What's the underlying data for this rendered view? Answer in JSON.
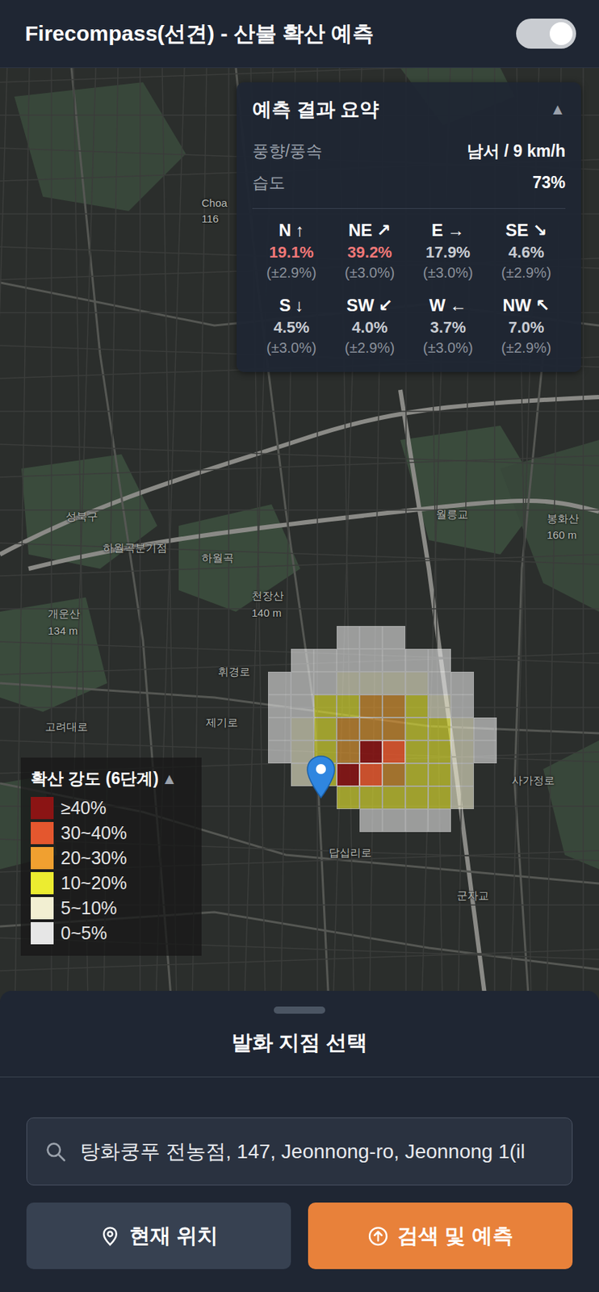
{
  "header": {
    "title": "Firecompass(선견) - 산불 확산 예측",
    "toggle_on": true
  },
  "summary": {
    "title": "예측 결과 요약",
    "collapse": "▲",
    "rows": [
      {
        "label": "풍향/풍속",
        "value": "남서 / 9 km/h"
      },
      {
        "label": "습도",
        "value": "73%"
      }
    ],
    "directions": [
      {
        "label": "N",
        "arrow": "↑",
        "pct": "19.1%",
        "err": "(±2.9%)",
        "highlighted": true
      },
      {
        "label": "NE",
        "arrow": "↗",
        "pct": "39.2%",
        "err": "(±3.0%)",
        "highlighted": true
      },
      {
        "label": "E",
        "arrow": "→",
        "pct": "17.9%",
        "err": "(±3.0%)",
        "highlighted": false
      },
      {
        "label": "SE",
        "arrow": "↘",
        "pct": "4.6%",
        "err": "(±2.9%)",
        "highlighted": false
      },
      {
        "label": "S",
        "arrow": "↓",
        "pct": "4.5%",
        "err": "(±3.0%)",
        "highlighted": false
      },
      {
        "label": "SW",
        "arrow": "↙",
        "pct": "4.0%",
        "err": "(±2.9%)",
        "highlighted": false
      },
      {
        "label": "W",
        "arrow": "←",
        "pct": "3.7%",
        "err": "(±3.0%)",
        "highlighted": false
      },
      {
        "label": "NW",
        "arrow": "↖",
        "pct": "7.0%",
        "err": "(±2.9%)",
        "highlighted": false
      }
    ]
  },
  "map": {
    "labels": [
      "Choa",
      "116",
      "성북구",
      "하월곡분기점",
      "하월곡",
      "천장산",
      "140 m",
      "개운산",
      "134 m",
      "월릉교",
      "봉화산",
      "160 m",
      "휘경로",
      "제기로",
      "고려대로",
      "사가정로",
      "답십리로",
      "군자교"
    ],
    "grid": [
      [
        null,
        null,
        null,
        5,
        5,
        5,
        null,
        null,
        null,
        null
      ],
      [
        null,
        5,
        5,
        5,
        5,
        5,
        5,
        5,
        null,
        null
      ],
      [
        5,
        5,
        5,
        4,
        4,
        4,
        4,
        5,
        5,
        null
      ],
      [
        5,
        5,
        3,
        3,
        2,
        2,
        3,
        4,
        5,
        null
      ],
      [
        5,
        4,
        3,
        2,
        2,
        2,
        3,
        3,
        4,
        5
      ],
      [
        5,
        4,
        3,
        2,
        0,
        1,
        3,
        3,
        4,
        5
      ],
      [
        null,
        4,
        3,
        0,
        1,
        2,
        3,
        3,
        4,
        null
      ],
      [
        null,
        null,
        null,
        3,
        3,
        3,
        3,
        3,
        4,
        null
      ],
      [
        null,
        null,
        null,
        null,
        5,
        5,
        5,
        5,
        null,
        null
      ]
    ]
  },
  "legend": {
    "title": "확산 강도 (6단계)",
    "toggle": "▲",
    "items": [
      {
        "label": "≥40%",
        "color": "#8b1414"
      },
      {
        "label": "30~40%",
        "color": "#e4572e"
      },
      {
        "label": "20~30%",
        "color": "#f0a030"
      },
      {
        "label": "10~20%",
        "color": "#ecec30"
      },
      {
        "label": "5~10%",
        "color": "#f2efd2"
      },
      {
        "label": "0~5%",
        "color": "#e6e6e6"
      }
    ]
  },
  "sheet": {
    "title": "발화 지점 선택",
    "search": {
      "value": "탕화쿵푸 전농점, 147, Jeonnong-ro, Jeonnong 1(il"
    },
    "buttons": [
      {
        "label": "현재 위치",
        "kind": "secondary"
      },
      {
        "label": "검색 및 예측",
        "kind": "primary"
      }
    ]
  }
}
